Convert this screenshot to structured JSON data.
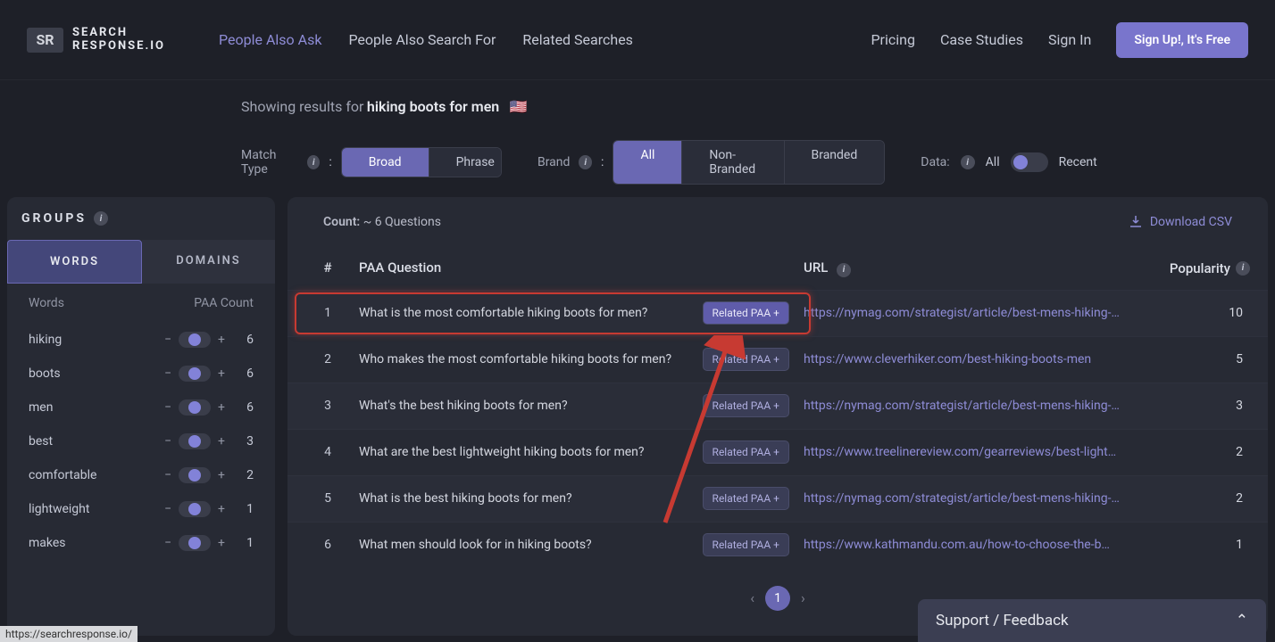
{
  "brand": {
    "badge": "SR",
    "name_line1": "SEARCH",
    "name_line2": "RESPONSE.IO"
  },
  "nav": {
    "links": [
      "People Also Ask",
      "People Also Search For",
      "Related Searches"
    ],
    "right": [
      "Pricing",
      "Case Studies",
      "Sign In"
    ],
    "signup": "Sign Up!, It's Free"
  },
  "showing": {
    "prefix": "Showing results for",
    "query": "hiking boots for men",
    "flag": "🇺🇸"
  },
  "filters": {
    "match_label": "Match Type",
    "match_opts": [
      "Broad",
      "Phrase"
    ],
    "brand_label": "Brand",
    "brand_opts": [
      "All",
      "Non-Branded",
      "Branded"
    ],
    "data_label": "Data:",
    "data_opts": [
      "All",
      "Recent"
    ]
  },
  "sidebar": {
    "title": "GROUPS",
    "tabs": [
      "WORDS",
      "DOMAINS"
    ],
    "col1": "Words",
    "col2": "PAA Count",
    "items": [
      {
        "word": "hiking",
        "count": "6"
      },
      {
        "word": "boots",
        "count": "6"
      },
      {
        "word": "men",
        "count": "6"
      },
      {
        "word": "best",
        "count": "3"
      },
      {
        "word": "comfortable",
        "count": "2"
      },
      {
        "word": "lightweight",
        "count": "1"
      },
      {
        "word": "makes",
        "count": "1"
      }
    ]
  },
  "content": {
    "count_label": "Count:",
    "count_val": "~ 6 Questions",
    "download": "Download CSV",
    "head": {
      "num": "#",
      "q": "PAA Question",
      "url": "URL",
      "pop": "Popularity"
    },
    "related_btn": "Related PAA +",
    "rows": [
      {
        "n": "1",
        "q": "What is the most comfortable hiking boots for men?",
        "url": "https://nymag.com/strategist/article/best-mens-hiking-…",
        "pop": "10",
        "hi": true,
        "highlight": true
      },
      {
        "n": "2",
        "q": "Who makes the most comfortable hiking boots for men?",
        "url": "https://www.cleverhiker.com/best-hiking-boots-men",
        "pop": "5"
      },
      {
        "n": "3",
        "q": "What's the best hiking boots for men?",
        "url": "https://nymag.com/strategist/article/best-mens-hiking-…",
        "pop": "3"
      },
      {
        "n": "4",
        "q": "What are the best lightweight hiking boots for men?",
        "url": "https://www.treelinereview.com/gearreviews/best-light…",
        "pop": "2"
      },
      {
        "n": "5",
        "q": "What is the best hiking boots for men?",
        "url": "https://nymag.com/strategist/article/best-mens-hiking-…",
        "pop": "2"
      },
      {
        "n": "6",
        "q": "What men should look for in hiking boots?",
        "url": "https://www.kathmandu.com.au/how-to-choose-the-b…",
        "pop": "1"
      }
    ],
    "page": "1"
  },
  "feedback": "Support / Feedback",
  "status_url": "https://searchresponse.io/"
}
